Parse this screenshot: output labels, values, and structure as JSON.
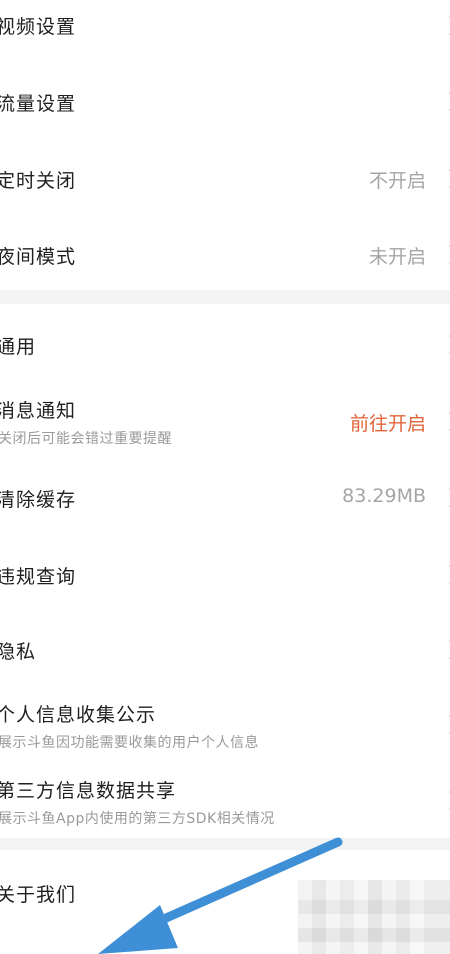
{
  "settings": {
    "video": {
      "label": "视频设置"
    },
    "traffic": {
      "label": "流量设置"
    },
    "timer": {
      "label": "定时关闭",
      "value": "不开启"
    },
    "night": {
      "label": "夜间模式",
      "value": "未开启"
    },
    "general": {
      "label": "通用"
    },
    "notify": {
      "label": "消息通知",
      "sub": "关闭后可能会错过重要提醒",
      "value": "前往开启"
    },
    "cache": {
      "label": "清除缓存",
      "value": "83.29MB"
    },
    "violation": {
      "label": "违规查询"
    },
    "privacy": {
      "label": "隐私"
    },
    "personal_info": {
      "label": "个人信息收集公示",
      "sub": "展示斗鱼因功能需要收集的用户个人信息"
    },
    "third_party": {
      "label": "第三方信息数据共享",
      "sub": "展示斗鱼App内使用的第三方SDK相关情况"
    },
    "about": {
      "label": "关于我们"
    }
  },
  "colors": {
    "accent": "#e0643a",
    "arrow": "#3f8fd6",
    "divider": "#f3f3f3"
  },
  "icons": {
    "chevron": "chevron-right-icon",
    "annotation": "pointer-arrow-icon"
  }
}
